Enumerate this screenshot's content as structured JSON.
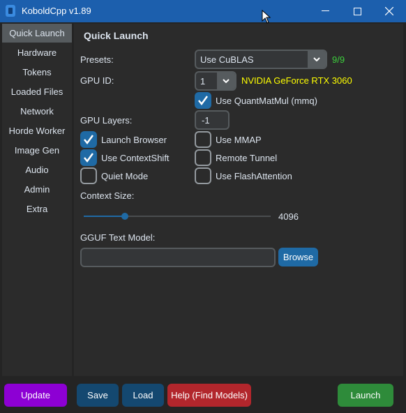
{
  "window": {
    "title": "KoboldCpp v1.89"
  },
  "sidebar": {
    "items": [
      {
        "label": "Quick Launch",
        "active": true
      },
      {
        "label": "Hardware"
      },
      {
        "label": "Tokens"
      },
      {
        "label": "Loaded Files"
      },
      {
        "label": "Network"
      },
      {
        "label": "Horde Worker"
      },
      {
        "label": "Image Gen"
      },
      {
        "label": "Audio"
      },
      {
        "label": "Admin"
      },
      {
        "label": "Extra"
      }
    ]
  },
  "main": {
    "heading": "Quick Launch",
    "presets": {
      "label": "Presets:",
      "value": "Use CuBLAS",
      "count": "9/9"
    },
    "gpu": {
      "label": "GPU ID:",
      "value": "1",
      "name": "NVIDIA GeForce RTX 3060"
    },
    "mmq": {
      "label": "Use QuantMatMul (mmq)",
      "checked": true
    },
    "gpu_layers": {
      "label": "GPU Layers:",
      "value": "-1"
    },
    "checkboxes": {
      "launch_browser": {
        "label": "Launch Browser",
        "checked": true
      },
      "use_mmap": {
        "label": "Use MMAP",
        "checked": false
      },
      "use_contextshift": {
        "label": "Use ContextShift",
        "checked": true
      },
      "remote_tunnel": {
        "label": "Remote Tunnel",
        "checked": false
      },
      "quiet_mode": {
        "label": "Quiet Mode",
        "checked": false
      },
      "use_flashattention": {
        "label": "Use FlashAttention",
        "checked": false
      }
    },
    "context_size": {
      "label": "Context Size:",
      "value": "4096",
      "slider_fraction": 0.22
    },
    "model": {
      "label": "GGUF Text Model:",
      "value": "",
      "browse_label": "Browse"
    }
  },
  "footer": {
    "update": "Update",
    "save": "Save",
    "load": "Load",
    "help": "Help (Find Models)",
    "launch": "Launch"
  },
  "colors": {
    "accent": "#1f6aa5",
    "update": "#8d00d4",
    "help": "#b2262c",
    "launch": "#2e8b3a",
    "count": "#3dd13d",
    "gpu_name": "#ffff00"
  }
}
